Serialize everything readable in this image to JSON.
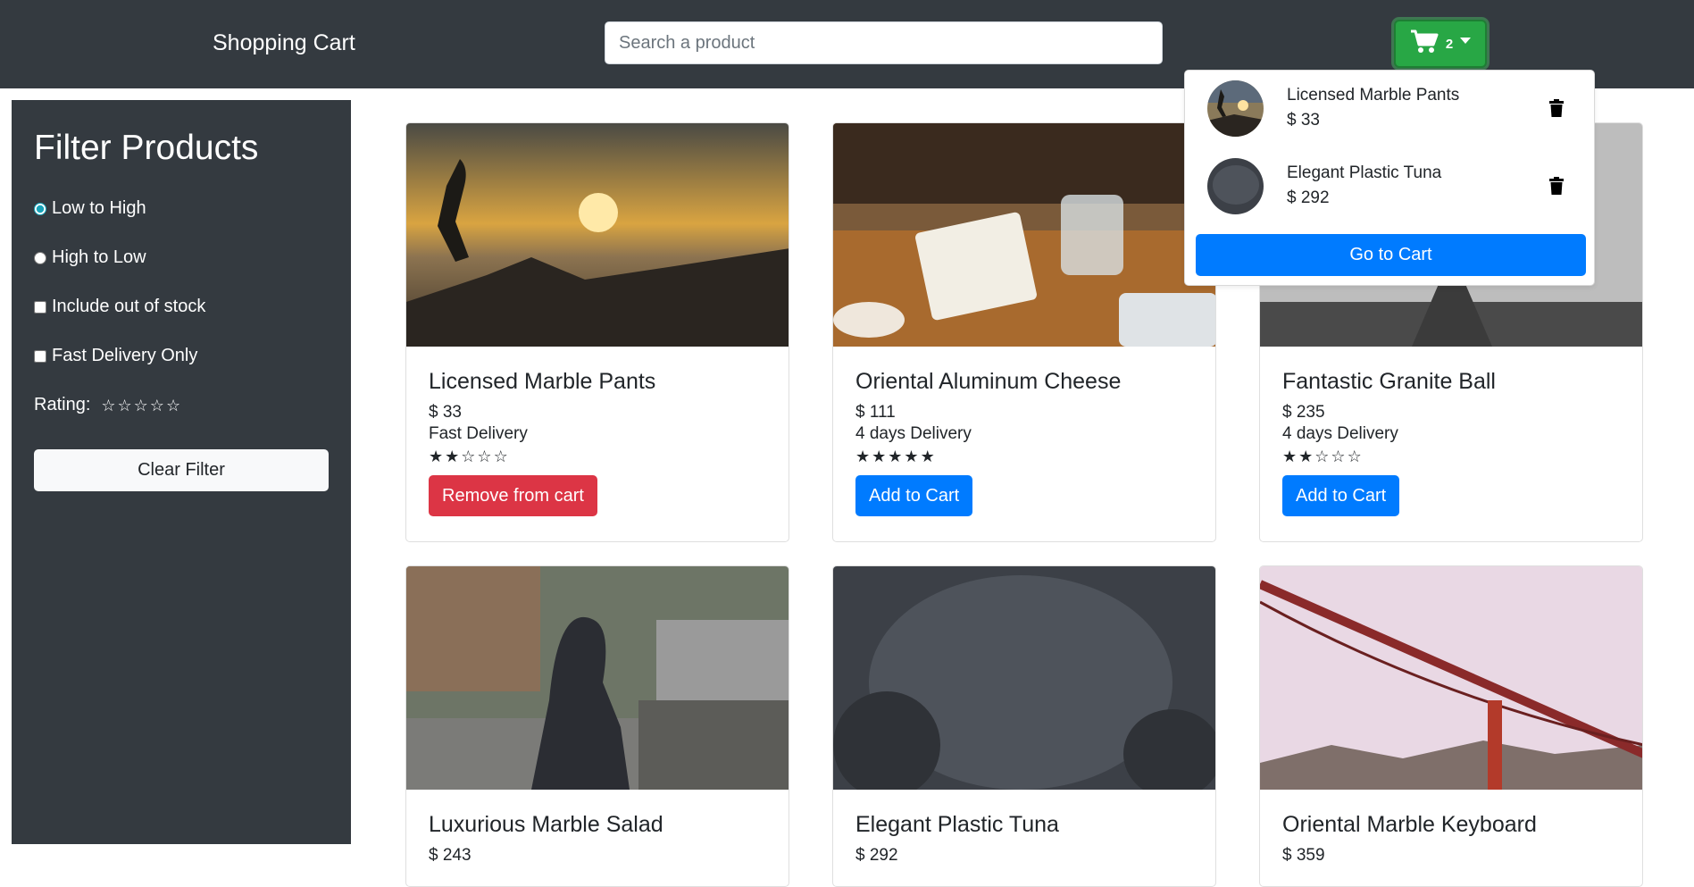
{
  "header": {
    "brand": "Shopping Cart",
    "search_placeholder": "Search a product",
    "cart_count": "2"
  },
  "sidebar": {
    "title": "Filter Products",
    "sort_low_high": "Low to High",
    "sort_high_low": "High to Low",
    "include_out_of_stock": "Include out of stock",
    "fast_delivery": "Fast Delivery Only",
    "rating_label": "Rating:",
    "clear_label": "Clear Filter"
  },
  "products": [
    {
      "name": "Licensed Marble Pants",
      "price": "$ 33",
      "delivery": "Fast Delivery",
      "rating": 2,
      "button": "Remove from cart",
      "in_cart": true
    },
    {
      "name": "Oriental Aluminum Cheese",
      "price": "$ 111",
      "delivery": "4 days Delivery",
      "rating": 5,
      "button": "Add to Cart",
      "in_cart": false
    },
    {
      "name": "Fantastic Granite Ball",
      "price": "$ 235",
      "delivery": "4 days Delivery",
      "rating": 2,
      "button": "Add to Cart",
      "in_cart": false
    },
    {
      "name": "Luxurious Marble Salad",
      "price": "$ 243"
    },
    {
      "name": "Elegant Plastic Tuna",
      "price": "$ 292"
    },
    {
      "name": "Oriental Marble Keyboard",
      "price": "$ 359"
    }
  ],
  "cart_dropdown": {
    "items": [
      {
        "name": "Licensed Marble Pants",
        "price": "$ 33"
      },
      {
        "name": "Elegant Plastic Tuna",
        "price": "$ 292"
      }
    ],
    "go_to_cart": "Go to Cart"
  },
  "colors": {
    "navbar": "#343a40",
    "cart_button": "#28a745",
    "primary": "#007bff",
    "danger": "#dc3545"
  },
  "icons": [
    "shopping-cart-icon",
    "caret-down-icon",
    "trash-icon",
    "star-icon"
  ]
}
